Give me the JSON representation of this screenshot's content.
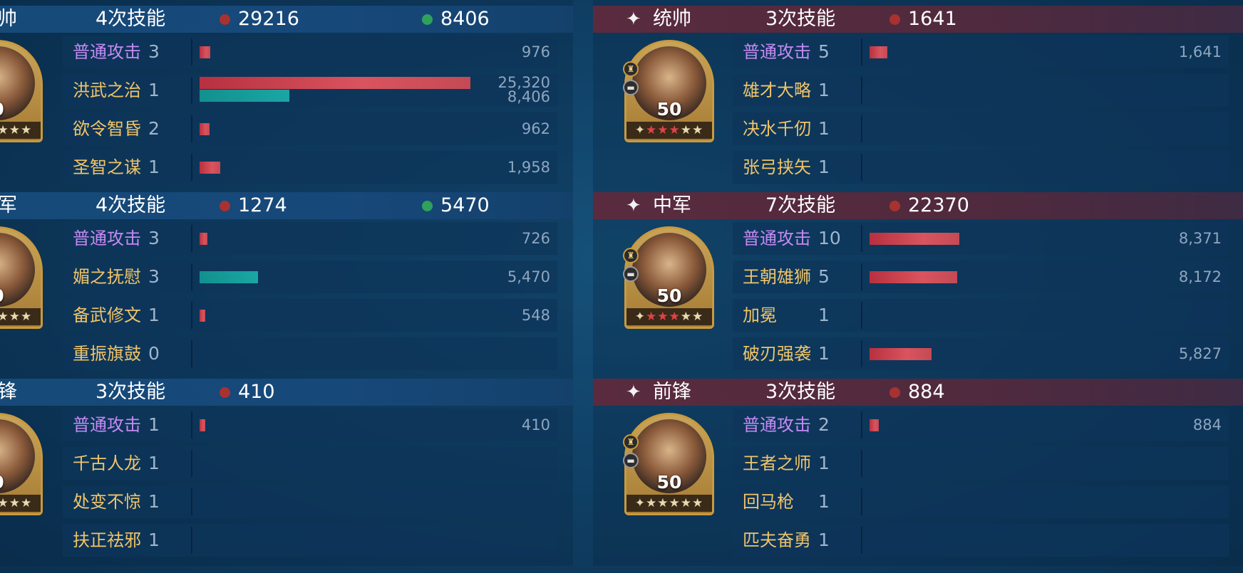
{
  "left": {
    "groups": [
      {
        "role": "统帅",
        "skill_count": "4次技能",
        "red_total": "29216",
        "green_total": "8406",
        "level": "0",
        "skills": [
          {
            "name": "普通攻击",
            "count": "3",
            "value": "976",
            "red": 976,
            "green": 0,
            "basic": true
          },
          {
            "name": "洪武之治",
            "count": "1",
            "value": "25,320",
            "value2": "8,406",
            "red": 25320,
            "green": 8406,
            "basic": false
          },
          {
            "name": "欲令智昏",
            "count": "2",
            "value": "962",
            "red": 962,
            "green": 0,
            "basic": false
          },
          {
            "name": "圣智之谋",
            "count": "1",
            "value": "1,958",
            "red": 1958,
            "green": 0,
            "basic": false
          }
        ]
      },
      {
        "role": "中军",
        "skill_count": "4次技能",
        "red_total": "1274",
        "green_total": "5470",
        "level": "0",
        "skills": [
          {
            "name": "普通攻击",
            "count": "3",
            "value": "726",
            "red": 726,
            "green": 0,
            "basic": true
          },
          {
            "name": "媚之抚慰",
            "count": "3",
            "value": "5,470",
            "red": 0,
            "green": 5470,
            "basic": false
          },
          {
            "name": "备武修文",
            "count": "1",
            "value": "548",
            "red": 548,
            "green": 0,
            "basic": false
          },
          {
            "name": "重振旗鼓",
            "count": "0",
            "value": "",
            "red": 0,
            "green": 0,
            "basic": false
          }
        ]
      },
      {
        "role": "前锋",
        "skill_count": "3次技能",
        "red_total": "410",
        "green_total": "",
        "level": "0",
        "skills": [
          {
            "name": "普通攻击",
            "count": "1",
            "value": "410",
            "red": 410,
            "green": 0,
            "basic": true
          },
          {
            "name": "千古人龙",
            "count": "1",
            "value": "",
            "red": 0,
            "green": 0,
            "basic": false
          },
          {
            "name": "处变不惊",
            "count": "1",
            "value": "",
            "red": 0,
            "green": 0,
            "basic": false
          },
          {
            "name": "扶正祛邪",
            "count": "1",
            "value": "",
            "red": 0,
            "green": 0,
            "basic": false
          }
        ]
      }
    ]
  },
  "right": {
    "groups": [
      {
        "role": "统帅",
        "skill_count": "3次技能",
        "red_total": "1641",
        "level": "50",
        "stars_red": 3,
        "stars_total": 6,
        "skills": [
          {
            "name": "普通攻击",
            "count": "5",
            "value": "1,641",
            "red": 1641,
            "basic": true
          },
          {
            "name": "雄才大略",
            "count": "1",
            "value": "",
            "red": 0,
            "basic": false
          },
          {
            "name": "决水千仞",
            "count": "1",
            "value": "",
            "red": 0,
            "basic": false
          },
          {
            "name": "张弓挟矢",
            "count": "1",
            "value": "",
            "red": 0,
            "basic": false
          }
        ]
      },
      {
        "role": "中军",
        "skill_count": "7次技能",
        "red_total": "22370",
        "level": "50",
        "stars_red": 3,
        "stars_total": 6,
        "skills": [
          {
            "name": "普通攻击",
            "count": "10",
            "value": "8,371",
            "red": 8371,
            "basic": true
          },
          {
            "name": "王朝雄狮",
            "count": "5",
            "value": "8,172",
            "red": 8172,
            "basic": false
          },
          {
            "name": "加冕",
            "count": "1",
            "value": "",
            "red": 0,
            "basic": false
          },
          {
            "name": "破刃强袭",
            "count": "1",
            "value": "5,827",
            "red": 5827,
            "basic": false
          }
        ]
      },
      {
        "role": "前锋",
        "skill_count": "3次技能",
        "red_total": "884",
        "level": "50",
        "stars_red": 0,
        "stars_total": 6,
        "skills": [
          {
            "name": "普通攻击",
            "count": "2",
            "value": "884",
            "red": 884,
            "basic": true
          },
          {
            "name": "王者之师",
            "count": "1",
            "value": "",
            "red": 0,
            "basic": false
          },
          {
            "name": "回马枪",
            "count": "1",
            "value": "",
            "red": 0,
            "basic": false
          },
          {
            "name": "匹夫奋勇",
            "count": "1",
            "value": "",
            "red": 0,
            "basic": false
          }
        ]
      }
    ]
  },
  "scale": {
    "left_max": 25320,
    "right_max": 25320
  },
  "colors": {
    "red_bar": "#c7404c",
    "green_bar": "#16a09e",
    "skill_gold": "#f0c469",
    "basic_purple": "#c58af4"
  }
}
